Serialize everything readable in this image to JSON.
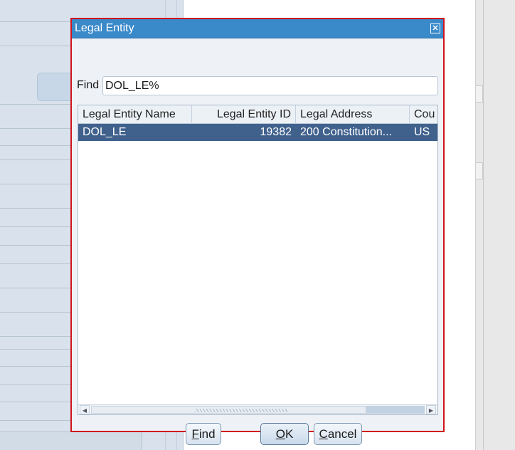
{
  "dialog": {
    "title": "Legal Entity",
    "close_icon": "close-icon"
  },
  "find": {
    "label": "Find",
    "value": "DOL_LE%"
  },
  "grid": {
    "columns": [
      "Legal Entity Name",
      "Legal Entity ID",
      "Legal Address",
      "Cou"
    ],
    "rows": [
      {
        "name": "DOL_LE",
        "id": "19382",
        "address": "200 Constitution...",
        "country": "US"
      }
    ]
  },
  "buttons": {
    "find": {
      "mnemonic": "F",
      "rest": "ind"
    },
    "ok": {
      "mnemonic": "O",
      "rest": "K"
    },
    "cancel": {
      "mnemonic": "C",
      "rest": "ancel"
    }
  },
  "colors": {
    "title_bar": "#3a89c9",
    "selected_row": "#41618d",
    "dialog_border": "#d0141b"
  }
}
